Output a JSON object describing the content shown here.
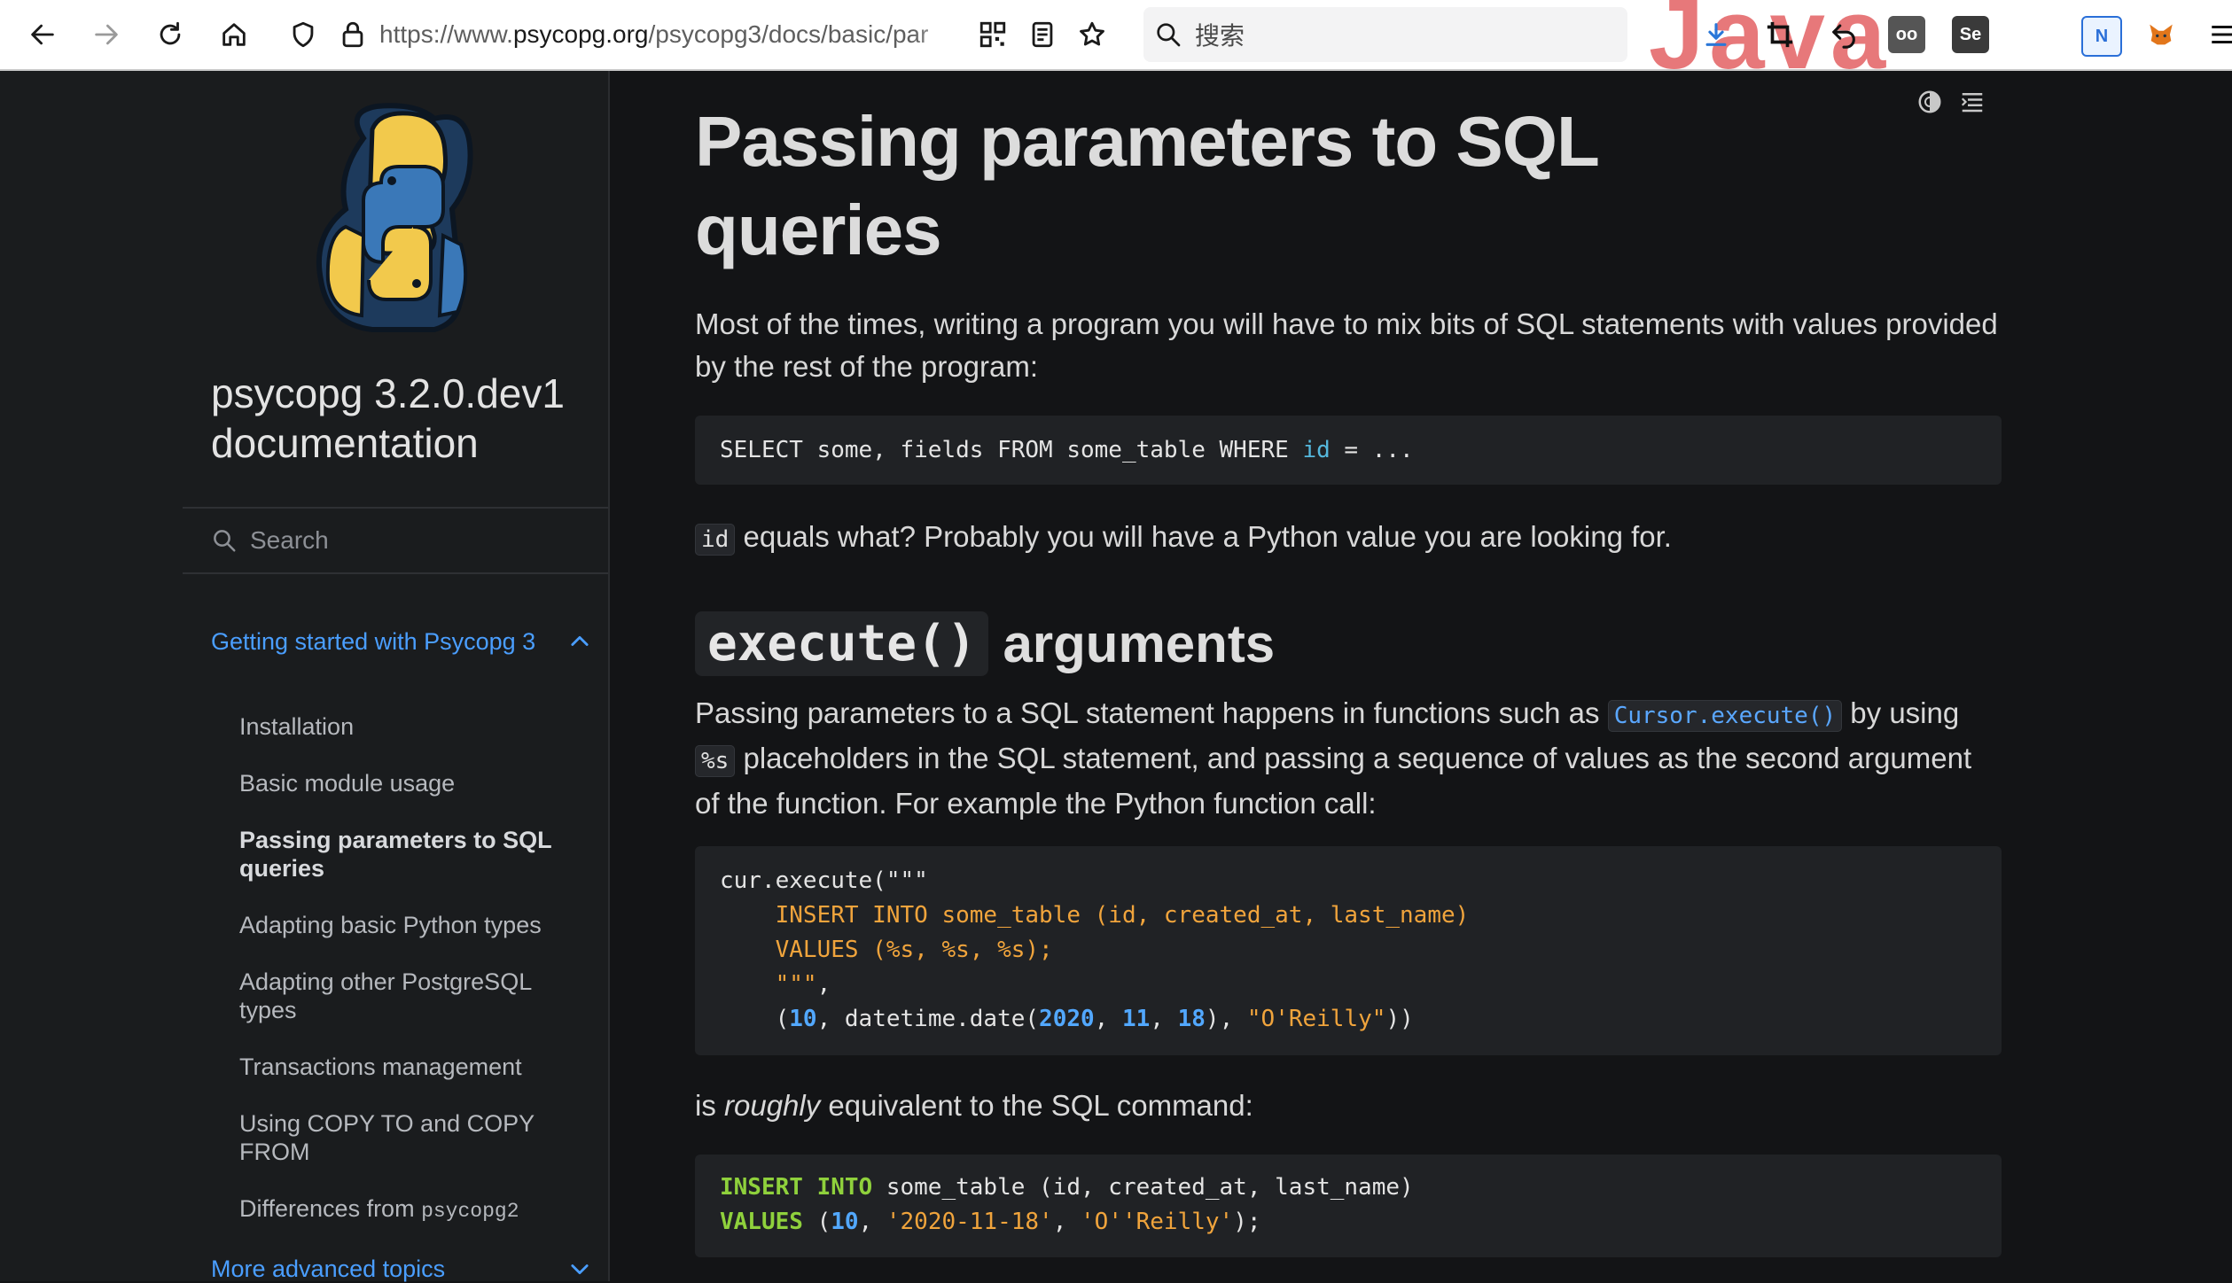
{
  "browser": {
    "url_prefix": "https://www.",
    "url_host": "psycopg.org",
    "url_path": "/psycopg3/docs/basic/par",
    "search_placeholder": "搜索",
    "overlay_text": "Java",
    "ext_labels": [
      "oo",
      "Se",
      "N"
    ]
  },
  "sidebar": {
    "brand_line1": "psycopg 3.2.0.dev1",
    "brand_line2": "documentation",
    "search_placeholder": "Search",
    "section1": "Getting started with Psycopg 3",
    "items": [
      "Installation",
      "Basic module usage",
      "Passing parameters to SQL queries",
      "Adapting basic Python types",
      "Adapting other PostgreSQL types",
      "Transactions management",
      "Using COPY TO and COPY FROM",
      "Differences from "
    ],
    "item8_code": "psycopg2",
    "section2": "More advanced topics"
  },
  "page": {
    "title": "Passing parameters to SQL queries",
    "intro": "Most of the times, writing a program you will have to mix bits of SQL statements with values provided by the rest of the program:",
    "code1": {
      "a": "SELECT some, fields FROM some_table WHERE ",
      "id": "id",
      "b": " = ..."
    },
    "p2_code": "id",
    "p2_text": " equals what? Probably you will have a Python value you are looking for.",
    "h2_code": "execute()",
    "h2_text": "arguments",
    "p3": {
      "a": "Passing parameters to a SQL statement happens in functions such as ",
      "link": "Cursor.execute()",
      "b": " by using ",
      "code": "%s",
      "c": " placeholders in the SQL statement, and passing a sequence of values as the second argument of the function. For example the Python function call:"
    },
    "code2": {
      "l1": "cur.execute(\"\"\"",
      "l2": "    INSERT INTO some_table (id, created_at, last_name)",
      "l3": "    VALUES (%s, %s, %s);",
      "l4a": "    \"\"\"",
      "l4b": ",",
      "l5a": "    (",
      "n1": "10",
      "l5b": ", datetime.date(",
      "n2": "2020",
      "sep1": ", ",
      "n3": "11",
      "sep2": ", ",
      "n4": "18",
      "l5c": "), ",
      "s1": "\"O'Reilly\"",
      "l5d": "))"
    },
    "p4_a": "is ",
    "p4_em": "roughly",
    "p4_b": " equivalent to the SQL command:",
    "code3": {
      "kw1": "INSERT INTO",
      "l1": " some_table (id, created_at, last_name)",
      "kw2": "VALUES",
      "l2a": " (",
      "n1": "10",
      "l2b": ", ",
      "s1": "'2020-11-18'",
      "l2c": ", ",
      "s2": "'O''Reilly'",
      "l2d": ");"
    }
  }
}
